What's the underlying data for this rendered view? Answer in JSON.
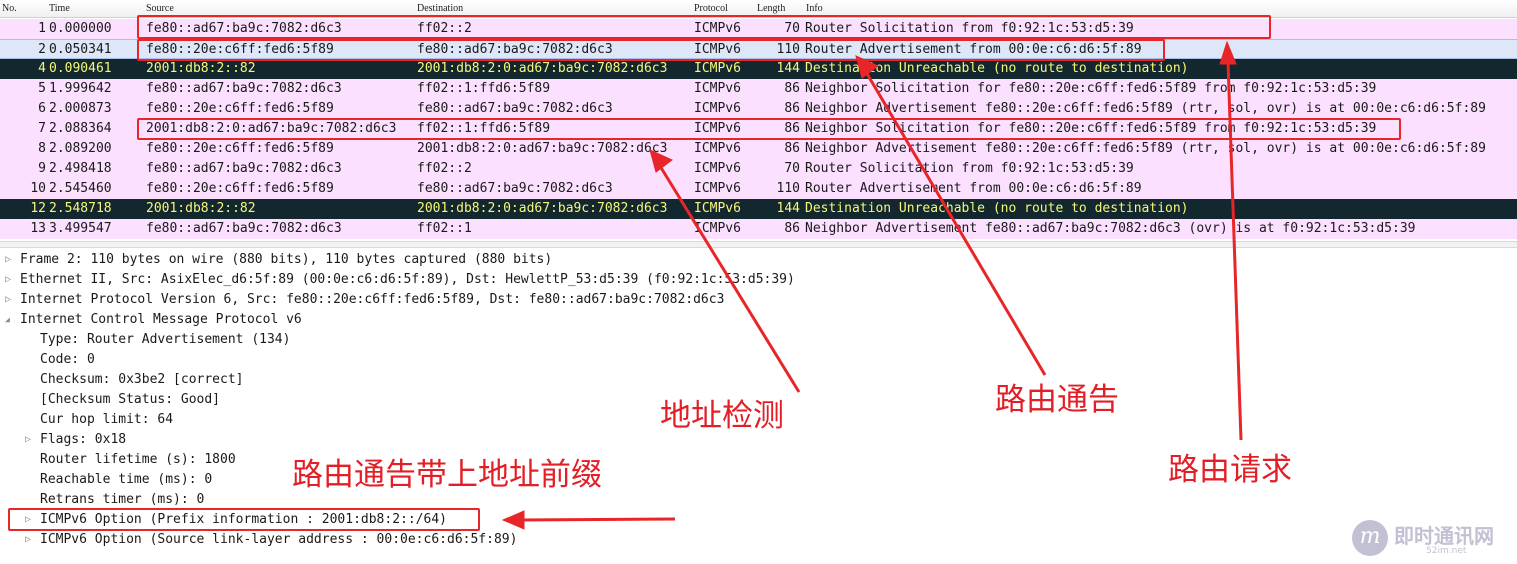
{
  "packet_list": {
    "columns": [
      "No.",
      "Time",
      "Source",
      "Destination",
      "Protocol",
      "Length",
      "Info"
    ],
    "rows": [
      {
        "no": "1",
        "time": "0.000000",
        "src": "fe80::ad67:ba9c:7082:d6c3",
        "dst": "ff02::2",
        "proto": "ICMPv6",
        "len": "70",
        "info": "Router Solicitation from f0:92:1c:53:d5:39",
        "style": "icmp"
      },
      {
        "no": "2",
        "time": "0.050341",
        "src": "fe80::20e:c6ff:fed6:5f89",
        "dst": "fe80::ad67:ba9c:7082:d6c3",
        "proto": "ICMPv6",
        "len": "110",
        "info": "Router Advertisement from 00:0e:c6:d6:5f:89",
        "style": "selected"
      },
      {
        "no": "4",
        "time": "0.090461",
        "src": "2001:db8:2::82",
        "dst": "2001:db8:2:0:ad67:ba9c:7082:d6c3",
        "proto": "ICMPv6",
        "len": "144",
        "info": "Destination Unreachable (no route to destination)",
        "style": "error"
      },
      {
        "no": "5",
        "time": "1.999642",
        "src": "fe80::ad67:ba9c:7082:d6c3",
        "dst": "ff02::1:ffd6:5f89",
        "proto": "ICMPv6",
        "len": "86",
        "info": "Neighbor Solicitation for fe80::20e:c6ff:fed6:5f89 from f0:92:1c:53:d5:39",
        "style": "icmp"
      },
      {
        "no": "6",
        "time": "2.000873",
        "src": "fe80::20e:c6ff:fed6:5f89",
        "dst": "fe80::ad67:ba9c:7082:d6c3",
        "proto": "ICMPv6",
        "len": "86",
        "info": "Neighbor Advertisement fe80::20e:c6ff:fed6:5f89 (rtr, sol, ovr) is at 00:0e:c6:d6:5f:89",
        "style": "icmp"
      },
      {
        "no": "7",
        "time": "2.088364",
        "src": "2001:db8:2:0:ad67:ba9c:7082:d6c3",
        "dst": "ff02::1:ffd6:5f89",
        "proto": "ICMPv6",
        "len": "86",
        "info": "Neighbor Solicitation for fe80::20e:c6ff:fed6:5f89 from f0:92:1c:53:d5:39",
        "style": "icmp"
      },
      {
        "no": "8",
        "time": "2.089200",
        "src": "fe80::20e:c6ff:fed6:5f89",
        "dst": "2001:db8:2:0:ad67:ba9c:7082:d6c3",
        "proto": "ICMPv6",
        "len": "86",
        "info": "Neighbor Advertisement fe80::20e:c6ff:fed6:5f89 (rtr, sol, ovr) is at 00:0e:c6:d6:5f:89",
        "style": "icmp"
      },
      {
        "no": "9",
        "time": "2.498418",
        "src": "fe80::ad67:ba9c:7082:d6c3",
        "dst": "ff02::2",
        "proto": "ICMPv6",
        "len": "70",
        "info": "Router Solicitation from f0:92:1c:53:d5:39",
        "style": "icmp"
      },
      {
        "no": "10",
        "time": "2.545460",
        "src": "fe80::20e:c6ff:fed6:5f89",
        "dst": "fe80::ad67:ba9c:7082:d6c3",
        "proto": "ICMPv6",
        "len": "110",
        "info": "Router Advertisement from 00:0e:c6:d6:5f:89",
        "style": "icmp"
      },
      {
        "no": "12",
        "time": "2.548718",
        "src": "2001:db8:2::82",
        "dst": "2001:db8:2:0:ad67:ba9c:7082:d6c3",
        "proto": "ICMPv6",
        "len": "144",
        "info": "Destination Unreachable (no route to destination)",
        "style": "error"
      },
      {
        "no": "13",
        "time": "3.499547",
        "src": "fe80::ad67:ba9c:7082:d6c3",
        "dst": "ff02::1",
        "proto": "ICMPv6",
        "len": "86",
        "info": "Neighbor Advertisement fe80::ad67:ba9c:7082:d6c3 (ovr) is at f0:92:1c:53:d5:39",
        "style": "icmp"
      }
    ]
  },
  "details": {
    "lines": [
      {
        "text": "Frame 2: 110 bytes on wire (880 bits), 110 bytes captured (880 bits)",
        "toggle": "collapsed"
      },
      {
        "text": "Ethernet II, Src: AsixElec_d6:5f:89 (00:0e:c6:d6:5f:89), Dst: HewlettP_53:d5:39 (f0:92:1c:53:d5:39)",
        "toggle": "collapsed"
      },
      {
        "text": "Internet Protocol Version 6, Src: fe80::20e:c6ff:fed6:5f89, Dst: fe80::ad67:ba9c:7082:d6c3",
        "toggle": "collapsed"
      },
      {
        "text": "Internet Control Message Protocol v6",
        "toggle": "expanded"
      },
      {
        "text": "Type: Router Advertisement (134)",
        "toggle": "none"
      },
      {
        "text": "Code: 0",
        "toggle": "none"
      },
      {
        "text": "Checksum: 0x3be2 [correct]",
        "toggle": "none"
      },
      {
        "text": "[Checksum Status: Good]",
        "toggle": "none"
      },
      {
        "text": "Cur hop limit: 64",
        "toggle": "none"
      },
      {
        "text": "Flags: 0x18",
        "toggle": "collapsed"
      },
      {
        "text": "Router lifetime (s): 1800",
        "toggle": "none"
      },
      {
        "text": "Reachable time (ms): 0",
        "toggle": "none"
      },
      {
        "text": "Retrans timer (ms): 0",
        "toggle": "none"
      },
      {
        "text": "ICMPv6 Option (Prefix information : 2001:db8:2::/64)",
        "toggle": "collapsed"
      },
      {
        "text": "ICMPv6 Option (Source link-layer address : 00:0e:c6:d6:5f:89)",
        "toggle": "collapsed"
      }
    ]
  },
  "annotations": {
    "address_detection": "地址检测",
    "router_advertisement": "路由通告",
    "router_solicitation": "路由请求",
    "ra_with_prefix": "路由通告带上地址前缀"
  },
  "colors": {
    "annotation_red": "#e8262a",
    "icmp_row": "#fce0ff",
    "selected_row": "#dde7f8",
    "error_row_bg": "#12272e",
    "error_row_fg": "#f7f779"
  },
  "watermark": {
    "name": "即时通讯网",
    "url": "52im.net"
  }
}
